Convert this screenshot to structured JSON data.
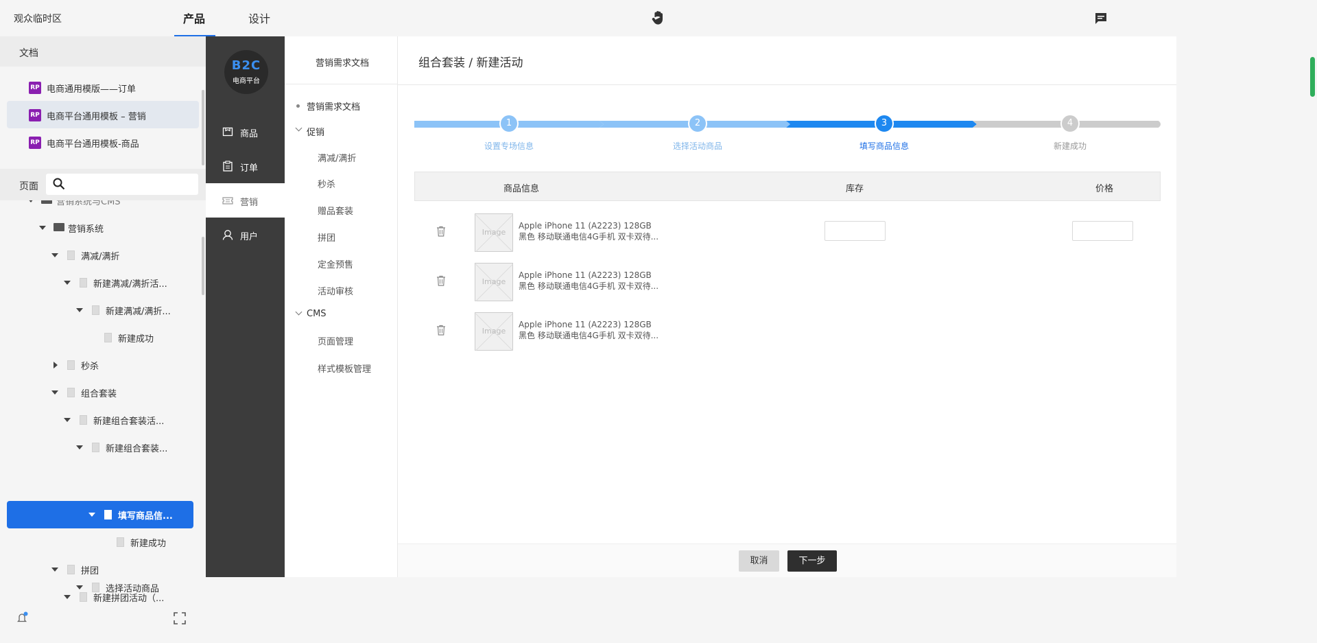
{
  "topbar": {
    "workspace": "观众临时区",
    "tabs": [
      {
        "label": "产品",
        "active": true
      },
      {
        "label": "设计",
        "active": false
      }
    ],
    "accent": "#1e6fe6"
  },
  "left_panel": {
    "section_title": "文档",
    "docs": [
      {
        "badge": "RP",
        "label": "电商通用模版——订单",
        "selected": false
      },
      {
        "badge": "RP",
        "label": "电商平台通用模板 – 营销",
        "selected": true
      },
      {
        "badge": "RP",
        "label": "电商平台通用模板-商品",
        "selected": false
      }
    ],
    "pages_label": "页面",
    "search_placeholder": "",
    "tree": [
      {
        "label": "营销系统与CMS",
        "type": "folder"
      },
      {
        "label": "营销系统",
        "type": "folder"
      },
      {
        "label": "满减/满折",
        "type": "page"
      },
      {
        "label": "新建满减/满折活...",
        "type": "page"
      },
      {
        "label": "新建满减/满折...",
        "type": "page"
      },
      {
        "label": "新建成功",
        "type": "page"
      },
      {
        "label": "秒杀",
        "type": "page"
      },
      {
        "label": "组合套装",
        "type": "page"
      },
      {
        "label": "新建组合套装活...",
        "type": "page"
      },
      {
        "label": "新建组合套装...",
        "type": "page"
      },
      {
        "label": "填写商品信...",
        "type": "page",
        "selected": true
      },
      {
        "label": "新建成功",
        "type": "page"
      },
      {
        "label": "拼团",
        "type": "page"
      },
      {
        "label": "新建拼团活动（...",
        "type": "page"
      },
      {
        "label": "选择活动商品",
        "type": "page"
      }
    ]
  },
  "app": {
    "logo_main": "B2C",
    "logo_sub": "电商平台",
    "nav": [
      {
        "label": "商品",
        "icon": "box-icon",
        "active": false
      },
      {
        "label": "订单",
        "icon": "clipboard-icon",
        "active": false
      },
      {
        "label": "营销",
        "icon": "ticket-icon",
        "active": true
      },
      {
        "label": "用户",
        "icon": "user-icon",
        "active": false
      }
    ],
    "submenu": {
      "header": "营销需求文档",
      "items": [
        {
          "label": "营销需求文档",
          "kind": "dot"
        },
        {
          "label": "促销",
          "kind": "group"
        },
        {
          "label": "满减/满折",
          "kind": "item"
        },
        {
          "label": "秒杀",
          "kind": "item"
        },
        {
          "label": "赠品套装",
          "kind": "item"
        },
        {
          "label": "拼团",
          "kind": "item"
        },
        {
          "label": "定金预售",
          "kind": "item"
        },
        {
          "label": "活动审核",
          "kind": "item"
        },
        {
          "label": "CMS",
          "kind": "group"
        },
        {
          "label": "页面管理",
          "kind": "item"
        },
        {
          "label": "样式模板管理",
          "kind": "item"
        }
      ]
    },
    "page_title": "组合套装 / 新建活动",
    "steps": [
      {
        "num": "1",
        "label": "设置专场信息",
        "state": "done"
      },
      {
        "num": "2",
        "label": "选择活动商品",
        "state": "done"
      },
      {
        "num": "3",
        "label": "填写商品信息",
        "state": "current"
      },
      {
        "num": "4",
        "label": "新建成功",
        "state": "todo"
      }
    ],
    "step_colors": {
      "done": "#8cc3f7",
      "current": "#1e88f0",
      "todo": "#cccccc",
      "done_text": "#7fb5ea",
      "current_text": "#1e6fe6",
      "todo_text": "#999999"
    },
    "table": {
      "headers": [
        "商品信息",
        "库存",
        "价格"
      ],
      "image_placeholder": "Image",
      "rows": [
        {
          "name": "Apple iPhone 11 (A2223) 128GB 黑色 移动联通电信4G手机 双卡双待...",
          "has_inputs": true
        },
        {
          "name": "Apple iPhone 11 (A2223) 128GB 黑色 移动联通电信4G手机 双卡双待...",
          "has_inputs": false
        },
        {
          "name": "Apple iPhone 11 (A2223) 128GB 黑色 移动联通电信4G手机 双卡双待...",
          "has_inputs": false
        }
      ]
    },
    "buttons": {
      "cancel": "取消",
      "next": "下一步"
    }
  }
}
